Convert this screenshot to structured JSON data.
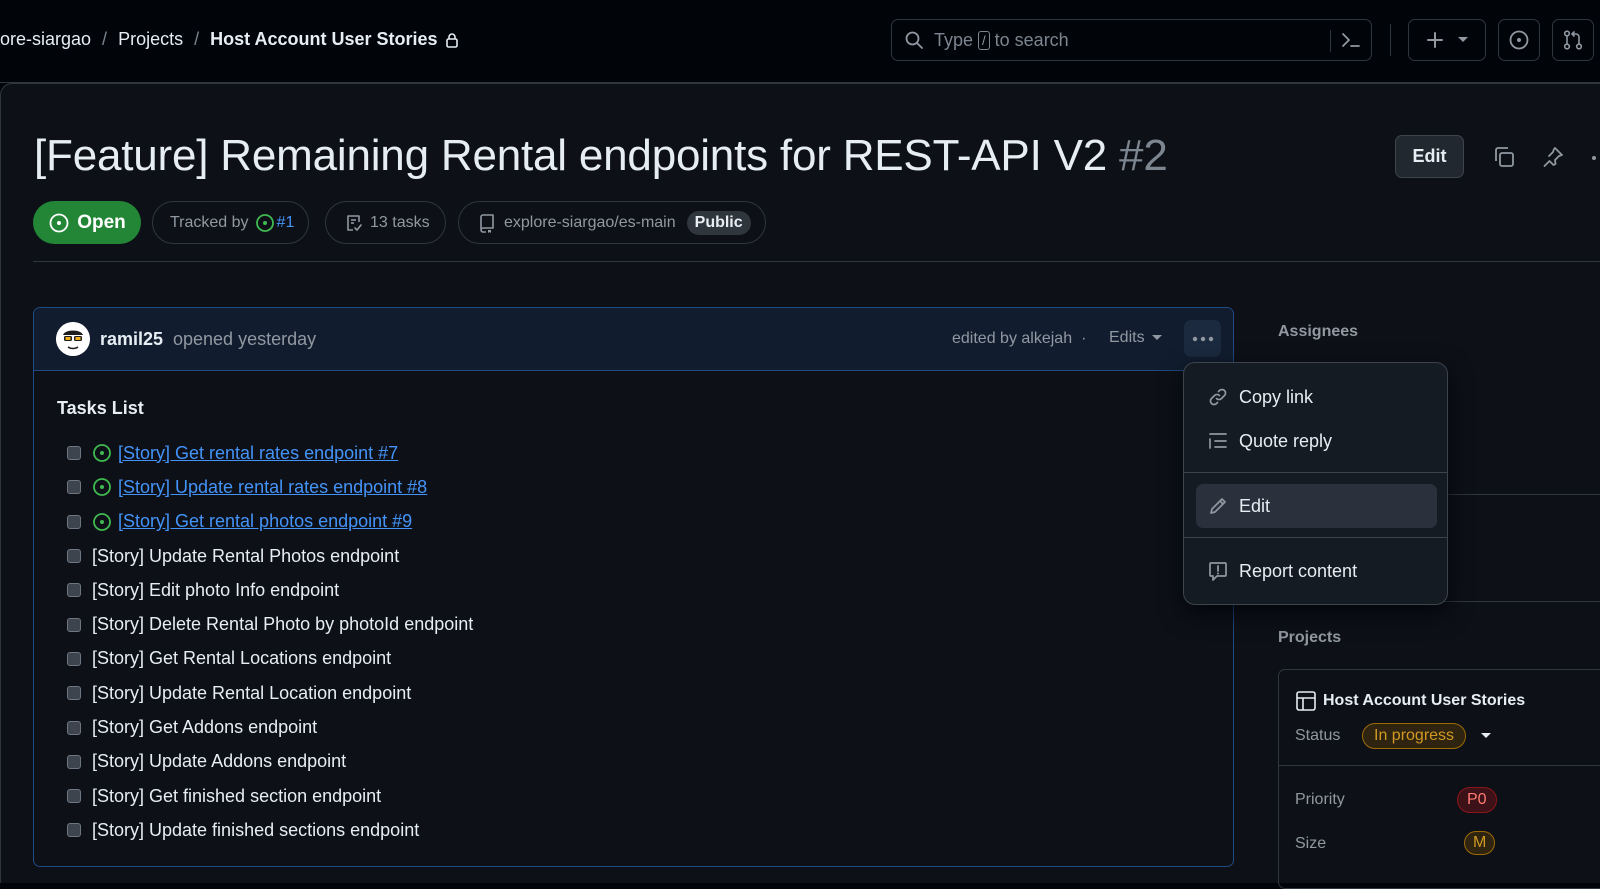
{
  "header": {
    "breadcrumb": {
      "repo_fragment": "ore-siargao",
      "projects": "Projects",
      "current": "Host Account User Stories"
    },
    "search": {
      "prefix": "Type",
      "key": "/",
      "suffix": "to search"
    }
  },
  "issue": {
    "title": "[Feature] Remaining Rental endpoints for REST-API V2",
    "number": "#2",
    "edit_label": "Edit",
    "state": "Open",
    "tracked_by_label": "Tracked by",
    "tracked_by_ref": "#1",
    "tasks_count": "13 tasks",
    "repo": "explore-siargao/es-main",
    "visibility": "Public"
  },
  "comment": {
    "author": "ramil25",
    "opened": "opened yesterday",
    "edited_by": "edited by alkejah",
    "dot": "·",
    "edits_label": "Edits",
    "heading": "Tasks List",
    "tasks": [
      {
        "label": "[Story] Get rental rates endpoint #7",
        "linked": true
      },
      {
        "label": "[Story] Update rental rates endpoint #8",
        "linked": true
      },
      {
        "label": "[Story] Get rental photos endpoint #9",
        "linked": true
      },
      {
        "label": "[Story] Update Rental Photos endpoint",
        "linked": false
      },
      {
        "label": "[Story] Edit photo Info endpoint",
        "linked": false
      },
      {
        "label": "[Story] Delete Rental Photo by photoId endpoint",
        "linked": false
      },
      {
        "label": "[Story] Get Rental Locations endpoint",
        "linked": false
      },
      {
        "label": "[Story] Update Rental Location endpoint",
        "linked": false
      },
      {
        "label": "[Story] Get Addons endpoint",
        "linked": false
      },
      {
        "label": "[Story] Update Addons endpoint",
        "linked": false
      },
      {
        "label": "[Story] Get finished section endpoint",
        "linked": false
      },
      {
        "label": "[Story] Update finished sections endpoint",
        "linked": false
      }
    ]
  },
  "menu": {
    "copy_link": "Copy link",
    "quote_reply": "Quote reply",
    "edit": "Edit",
    "report": "Report content"
  },
  "sidebar": {
    "assignees_label": "Assignees",
    "projects_label": "Projects",
    "project": {
      "name": "Host Account User Stories",
      "status_label": "Status",
      "status_value": "In progress",
      "priority_label": "Priority",
      "priority_value": "P0",
      "size_label": "Size",
      "size_value": "M"
    }
  },
  "colors": {
    "open_green": "#238636",
    "link_blue": "#4493f8",
    "status_yellow": "#d29922",
    "priority_red": "#ff7b72"
  }
}
